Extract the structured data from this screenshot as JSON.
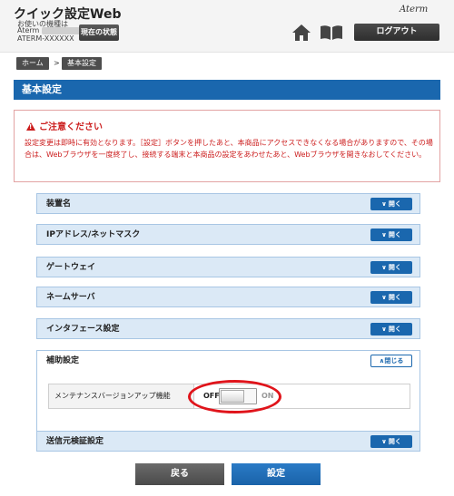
{
  "header": {
    "app_title": "クイック設定Web",
    "model_label": "お使いの機種は",
    "model_name": "Aterm",
    "model_id": "ATERM-XXXXXX",
    "status_button": "現在の状態",
    "logo": "Aterm",
    "home_icon": "home-icon",
    "manual_icon": "manual-book-icon",
    "logout_button": "ログアウト"
  },
  "breadcrumb": {
    "home": "ホーム",
    "separator": ">",
    "current": "基本設定"
  },
  "page_title": "基本設定",
  "caution": {
    "heading": "ご注意ください",
    "body": "設定変更は即時に有効となります。［設定］ボタンを押したあと、本商品にアクセスできなくなる場合がありますので、その場合は、Webブラウザを一度終了し、接続する端末と本商品の設定をあわせたあと、Webブラウザを開きなおしてください。",
    "color": "#cc1d1d"
  },
  "sections": [
    {
      "label": "装置名",
      "button": "開く"
    },
    {
      "label": "IPアドレス/ネットマスク",
      "button": "開く"
    },
    {
      "label": "ゲートウェイ",
      "button": "開く"
    },
    {
      "label": "ネームサーバ",
      "button": "開く"
    },
    {
      "label": "インタフェース設定",
      "button": "開く"
    },
    {
      "label": "補助設定",
      "button": "閉じる"
    },
    {
      "label": "送信元検証設定",
      "button": "開く"
    }
  ],
  "aux_setting": {
    "label": "メンテナンスバージョンアップ機能",
    "off": "OFF",
    "on": "ON",
    "state": "OFF"
  },
  "buttons": {
    "back": "戻る",
    "apply": "設定"
  },
  "colors": {
    "primary": "#1a67ae",
    "section_bg": "#dbe9f6",
    "highlight": "#e0141b"
  }
}
